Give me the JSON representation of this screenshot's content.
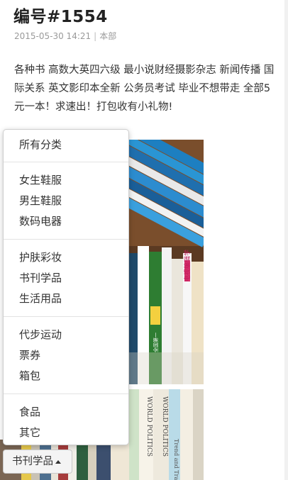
{
  "post": {
    "title": "编号#1554",
    "date": "2015-05-30 14:21",
    "separator": "|",
    "location": "本部",
    "description": "各种书 高数大英四六级 最小说财经摄影杂志 新闻传播 国际关系 英文影印本全新 公务员考试 毕业不想带走 全部5元一本！求速出！打包收有小礼物!"
  },
  "photos": {
    "photo1_texts": {
      "book_a": "电视编辑学",
      "book_b": "全国第一"
    },
    "photo2_texts": {
      "book_a": "WORLD POLITICS",
      "book_b": "WORLD POLITICS",
      "book_c": "Trend and Tra"
    }
  },
  "category_menu": {
    "items": [
      "所有分类",
      "女生鞋服",
      "男生鞋服",
      "数码电器",
      "护肤彩妆",
      "书刊学品",
      "生活用品",
      "代步运动",
      "票券",
      "箱包",
      "食品",
      "其它"
    ]
  },
  "category_button": {
    "label": "书刊学品"
  }
}
